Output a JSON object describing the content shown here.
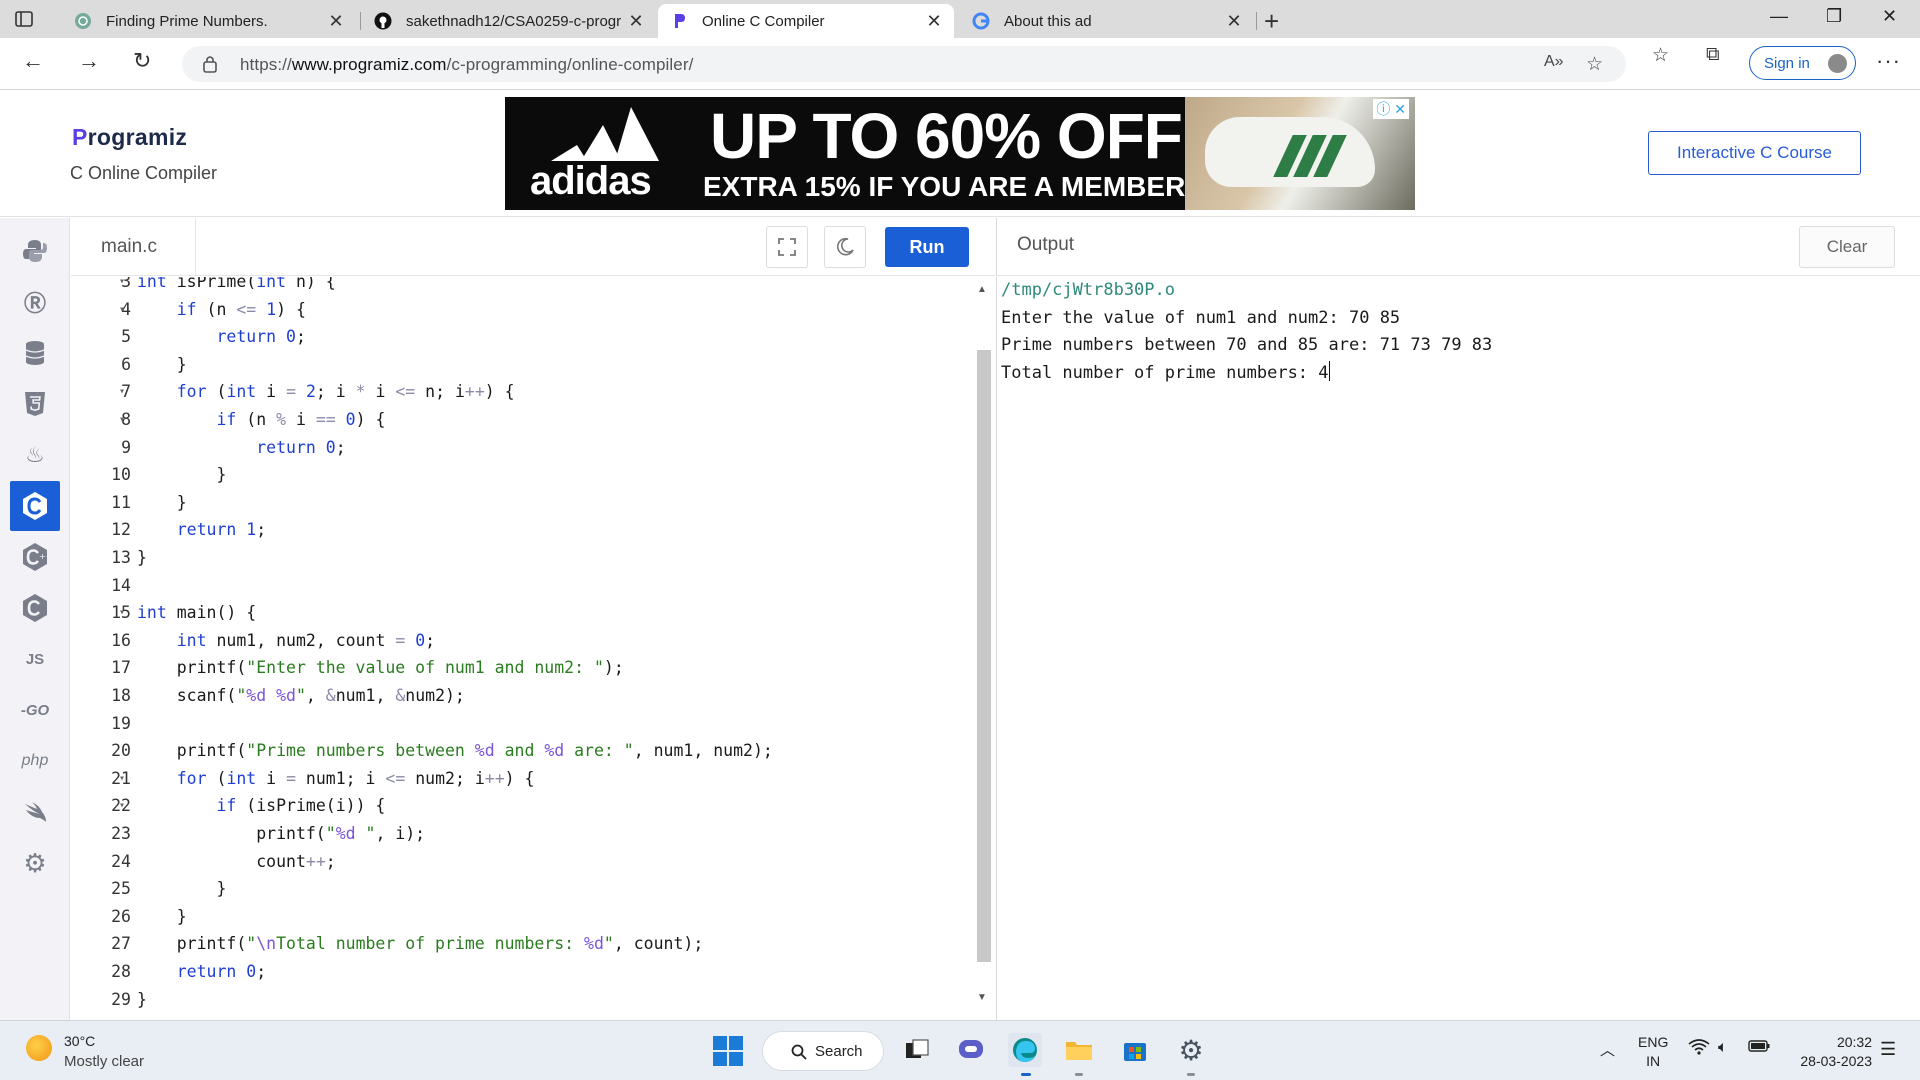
{
  "browser": {
    "tabs": [
      {
        "title": "Finding Prime Numbers.",
        "active": false
      },
      {
        "title": "sakethnadh12/CSA0259-c-progr",
        "active": false
      },
      {
        "title": "Online C Compiler",
        "active": true
      },
      {
        "title": "About this ad",
        "active": false
      }
    ],
    "url_prefix": "https://",
    "url_domain": "www.programiz.com",
    "url_path": "/c-programming/online-compiler/",
    "signin_label": "Sign in"
  },
  "header": {
    "logo": "rogramiz",
    "logo_first": "P",
    "subtitle": "C Online Compiler",
    "course_button": "Interactive C Course",
    "ad": {
      "brand": "adidas",
      "headline": "UP TO 60% OFF",
      "subline": "EXTRA 15% IF YOU ARE A MEMBER"
    }
  },
  "rail": {
    "items": [
      "python",
      "r",
      "sql",
      "html",
      "java",
      "c",
      "c++",
      "c#",
      "JS",
      "GO",
      "php",
      "swift",
      "rust"
    ],
    "active": "c"
  },
  "editor": {
    "filename": "main.c",
    "run_label": "Run"
  },
  "output": {
    "title": "Output",
    "clear_label": "Clear",
    "lines": [
      "/tmp/cjWtr8b30P.o",
      "Enter the value of num1 and num2: 70 85",
      "Prime numbers between 70 and 85 are: 71 73 79 83",
      "Total number of prime numbers: 4"
    ]
  },
  "taskbar": {
    "temperature": "30°C",
    "condition": "Mostly clear",
    "search_label": "Search",
    "lang_line1": "ENG",
    "lang_line2": "IN",
    "time": "20:32",
    "date": "28-03-2023"
  },
  "colors": {
    "accent": "#1a5fd6",
    "keyword": "#1f3fd0",
    "string": "#2a7d1e",
    "format_spec": "#7a55d9",
    "output_path": "#2e8a7a"
  }
}
